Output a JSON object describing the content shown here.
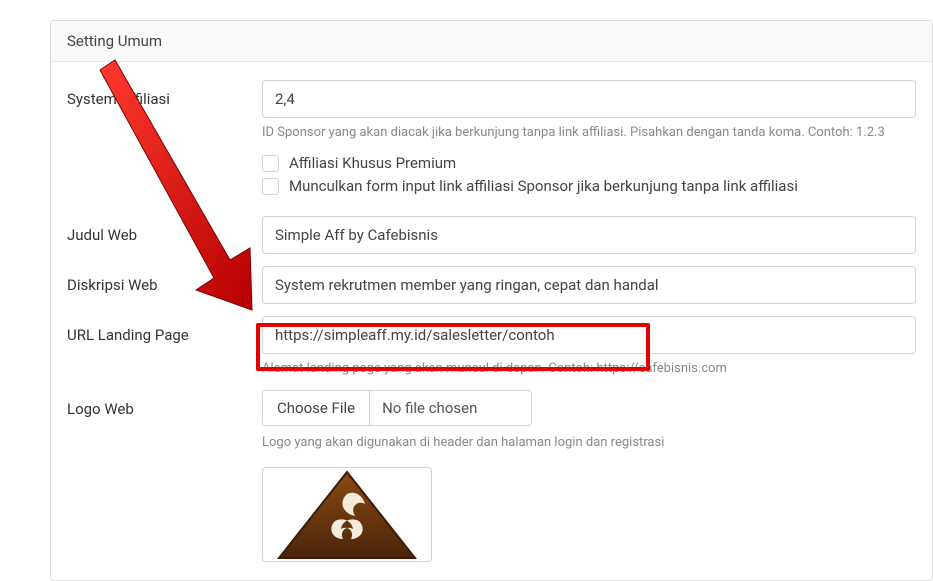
{
  "panel": {
    "title": "Setting Umum"
  },
  "affiliation": {
    "label": "System Affiliasi",
    "value": "2,4",
    "help": "ID Sponsor yang akan diacak jika berkunjung tanpa link affiliasi. Pisahkan dengan tanda koma. Contoh: 1.2.3",
    "cb1_label": "Affiliasi Khusus Premium",
    "cb2_label": "Munculkan form input link affiliasi Sponsor jika berkunjung tanpa link affiliasi"
  },
  "web_title": {
    "label": "Judul Web",
    "value": "Simple Aff by Cafebisnis"
  },
  "web_desc": {
    "label": "Diskripsi Web",
    "value": "System rekrutmen member yang ringan, cepat dan handal"
  },
  "landing": {
    "label": "URL Landing Page",
    "value": "https://simpleaff.my.id/salesletter/contoh",
    "help": "Alamat landing page yang akan muncul di depan. Contoh: https://cafebisnis.com"
  },
  "logo": {
    "label": "Logo Web",
    "choose": "Choose File",
    "no_file": "No file chosen",
    "help": "Logo yang akan digunakan di header dan halaman login dan registrasi"
  }
}
